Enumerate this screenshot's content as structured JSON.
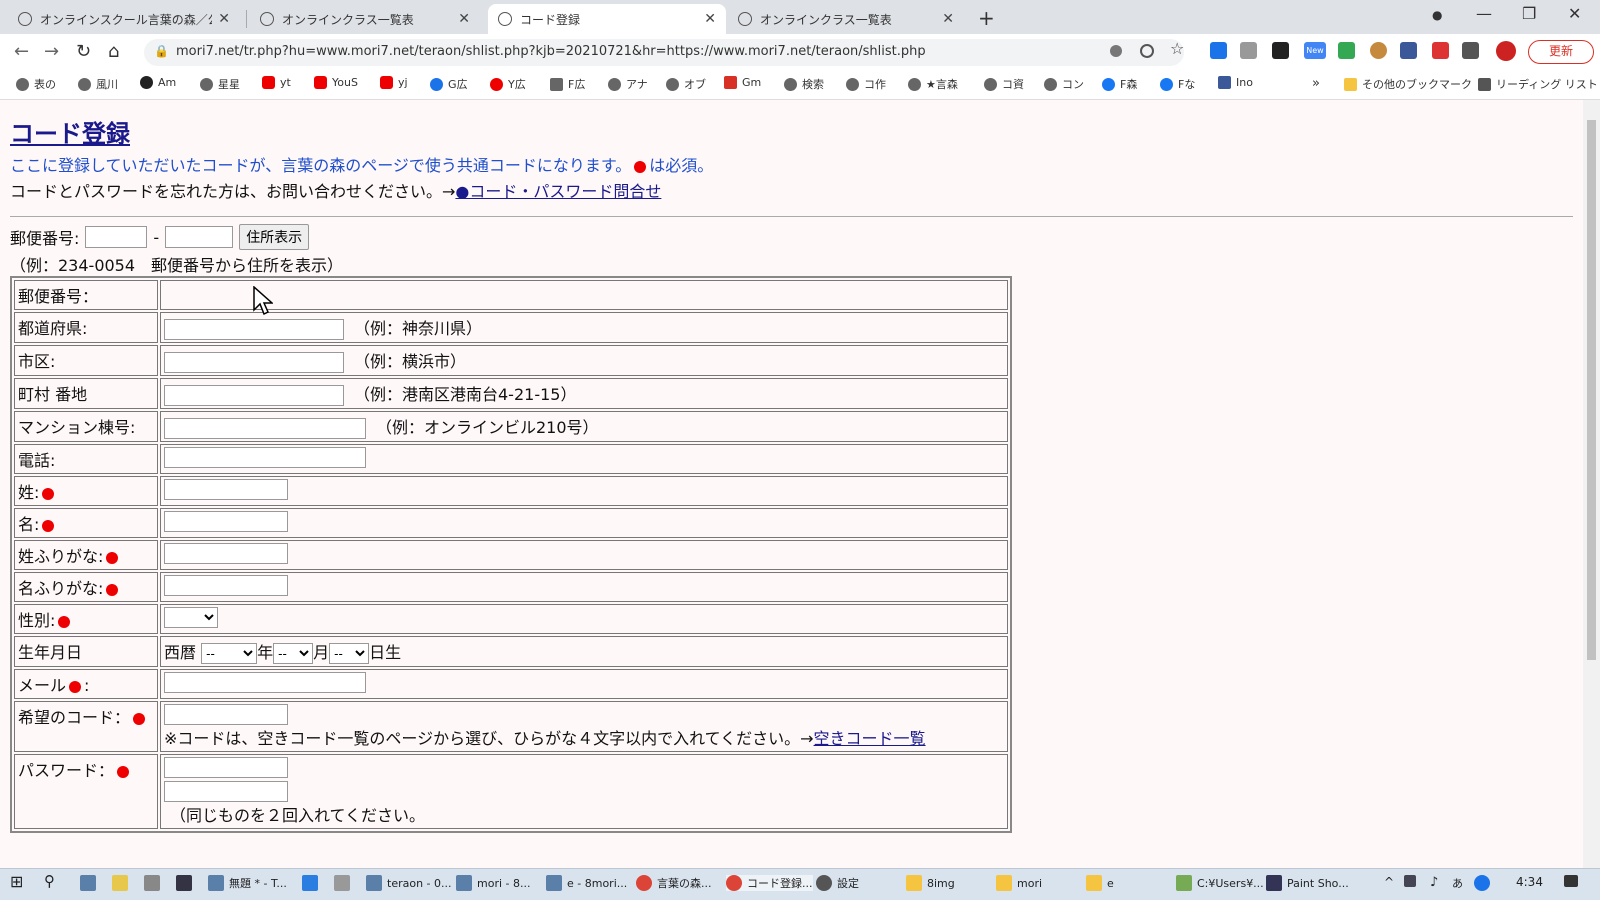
{
  "tabs": [
    {
      "title": "オンラインスクール言葉の森／公式ホ",
      "close": "✕"
    },
    {
      "title": "オンラインクラス一覧表",
      "close": "✕"
    },
    {
      "title": "コード登録",
      "close": "✕"
    },
    {
      "title": "オンラインクラス一覧表",
      "close": "✕"
    }
  ],
  "newtab": "+",
  "window_controls": {
    "minimize": "—",
    "restore": "❐",
    "close": "✕"
  },
  "nav": {
    "back": "←",
    "forward": "→",
    "reload": "↻",
    "home": "⌂"
  },
  "address": "mori7.net/tr.php?hu=www.mori7.net/teraon/shlist.php?kjb=20210721&hr=https://www.mori7.net/teraon/shlist.php",
  "update_label": "更新",
  "extension_badge": "New",
  "bookmarks": [
    "表の",
    "風川",
    "Am",
    "星星",
    "yt",
    "YouS",
    "yj",
    "G広",
    "Y広",
    "F広",
    "アナ",
    "オブ",
    "Gm",
    "検索",
    "コ作",
    "★言森",
    "コ資",
    "コン",
    "F森",
    "Fな",
    "Ino"
  ],
  "bookmarks_more": "»",
  "bookmarks_other": "その他のブックマーク",
  "reading_list": "リーディング リスト",
  "page": {
    "title": "コード登録",
    "intro_before": "ここに登録していただいたコードが、言葉の森のページで使う共通コードになります。",
    "intro_after": "は必須。",
    "contact_text": "コードとパスワードを忘れた方は、お問い合わせください。→",
    "contact_link": "●コード・パスワード問合せ",
    "zip_label": "郵便番号:",
    "zip_separator": "-",
    "zip_button": "住所表示",
    "zip_example": "（例：234-0054　郵便番号から住所を表示）"
  },
  "form": {
    "postal": "郵便番号：",
    "prefecture": {
      "label": "都道府県:",
      "hint": "（例：神奈川県）"
    },
    "city": {
      "label": "市区:",
      "hint": "（例：横浜市）"
    },
    "town": {
      "label": "町村 番地",
      "hint": "（例：港南区港南台4-21-15）"
    },
    "building": {
      "label": "マンション棟号:",
      "hint": "（例：オンラインビル210号）"
    },
    "phone": "電話:",
    "last_name": "姓:",
    "first_name": "名:",
    "last_kana": "姓ふりがな:",
    "first_kana": "名ふりがな:",
    "gender": "性別:",
    "birthday": {
      "label": "生年月日",
      "era": "西暦",
      "year_select": "--",
      "year_unit": "年",
      "month_select": "--",
      "month_unit": "月",
      "day_select": "--",
      "day_unit": "日生"
    },
    "email": {
      "label": "メール",
      "suffix": ":"
    },
    "code": {
      "label": "希望のコード：",
      "note": "※コードは、空きコード一覧のページから選び、ひらがな４文字以内で入れてください。→",
      "link": "空きコード一覧"
    },
    "password": {
      "label": "パスワード：",
      "note": "（同じものを２回入れてください。"
    }
  },
  "taskbar": {
    "items": [
      "無題 * - T...",
      "teraon - 0...",
      "mori - 8...",
      "e - 8mori...",
      "言葉の森...",
      "コード登録...",
      "設定",
      "8img",
      "mori",
      "e",
      "C:¥Users¥...",
      "Paint Sho..."
    ],
    "time": "4:34",
    "ime": "あ"
  },
  "colors": {
    "required_dot": "#e00000",
    "link": "#1a1a8c",
    "intro": "#1f4fcc",
    "page_bg": "#fff8f8"
  }
}
